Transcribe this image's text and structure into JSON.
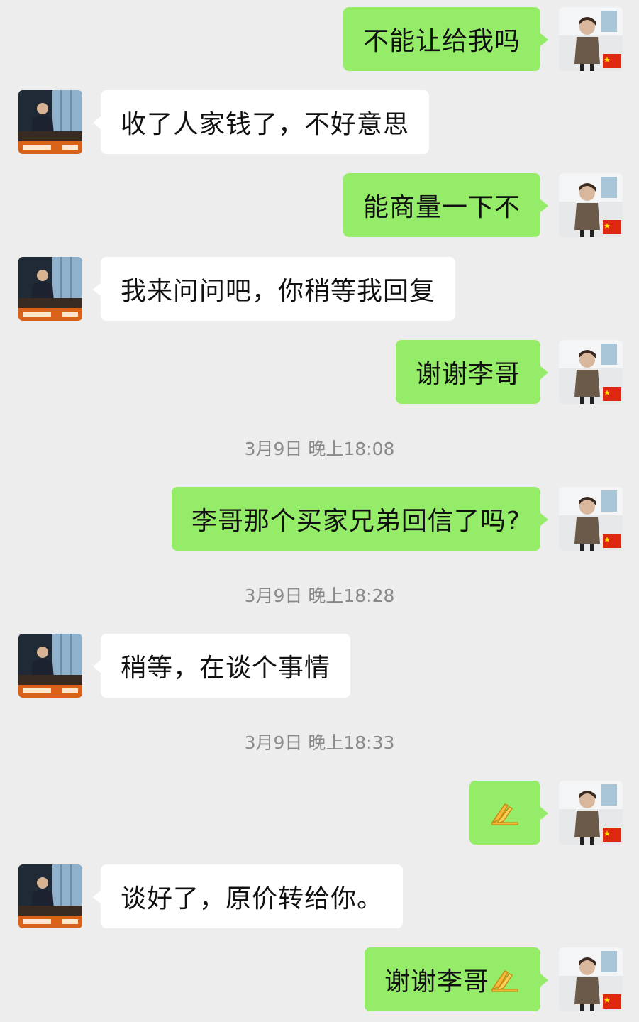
{
  "colors": {
    "background": "#ededed",
    "me_bubble": "#95ec69",
    "them_bubble": "#ffffff",
    "timestamp": "#8a8a8a"
  },
  "me_avatar": "child-avatar-with-flag",
  "them_avatar": "businessman-office-avatar",
  "messages": [
    {
      "type": "msg",
      "from": "me",
      "text": "不能让给我吗"
    },
    {
      "type": "msg",
      "from": "them",
      "text": "收了人家钱了，不好意思"
    },
    {
      "type": "msg",
      "from": "me",
      "text": "能商量一下不"
    },
    {
      "type": "msg",
      "from": "them",
      "text": "我来问问吧，你稍等我回复"
    },
    {
      "type": "msg",
      "from": "me",
      "text": "谢谢李哥"
    },
    {
      "type": "time",
      "text": "3月9日 晚上18:08"
    },
    {
      "type": "msg",
      "from": "me",
      "text": "李哥那个买家兄弟回信了吗?"
    },
    {
      "type": "time",
      "text": "3月9日 晚上18:28"
    },
    {
      "type": "msg",
      "from": "them",
      "text": "稍等，在谈个事情"
    },
    {
      "type": "time",
      "text": "3月9日 晚上18:33"
    },
    {
      "type": "msg",
      "from": "me",
      "text": "",
      "emoji": "folded-hands-emoji"
    },
    {
      "type": "msg",
      "from": "them",
      "text": "谈好了，原价转给你。"
    },
    {
      "type": "msg",
      "from": "me",
      "text": "谢谢李哥",
      "emoji": "folded-hands-emoji"
    }
  ]
}
